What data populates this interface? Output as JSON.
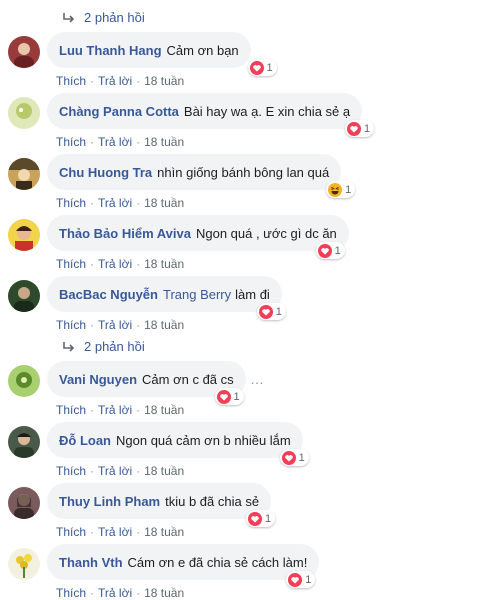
{
  "reply_links": [
    {
      "label": "2 phản hồi"
    },
    {
      "label": "2 phản hồi"
    }
  ],
  "actions": {
    "like": "Thích",
    "reply": "Trả lời",
    "sep": "·"
  },
  "comments": [
    {
      "author": "Luu Thanh Hang",
      "tag": "",
      "text": "Cảm ơn bạn",
      "time": "18 tuần",
      "reaction": "love",
      "count": "1",
      "avatar_color": "#9a3b3b"
    },
    {
      "author": "Chàng Panna Cotta",
      "tag": "",
      "text": "Bài hay wa ạ. E xin chia sẻ ạ",
      "time": "18 tuần",
      "reaction": "love",
      "count": "1",
      "avatar_color": "#b9c86a"
    },
    {
      "author": "Chu Huong Tra",
      "tag": "",
      "text": "nhìn giống bánh bông lan quá",
      "time": "18 tuần",
      "reaction": "haha",
      "count": "1",
      "avatar_color": "#8a6a3a"
    },
    {
      "author": "Thảo Bảo Hiểm Aviva",
      "tag": "",
      "text": "Ngon quá , ước gì dc ăn",
      "time": "18 tuần",
      "reaction": "love",
      "count": "1",
      "avatar_color": "#e0b24a"
    },
    {
      "author": "BacBac Nguyễn",
      "tag": "Trang Berry",
      "text": "làm đi",
      "time": "18 tuần",
      "reaction": "love",
      "count": "1",
      "avatar_color": "#2f4a2a"
    },
    {
      "author": "Vani Nguyen",
      "tag": "",
      "text": "Cảm ơn c đã cs",
      "time": "18 tuần",
      "reaction": "love",
      "count": "1",
      "avatar_color": "#7fae4a"
    },
    {
      "author": "Đỗ Loan",
      "tag": "",
      "text": "Ngon quá cảm ơn b nhiều lắm",
      "time": "18 tuần",
      "reaction": "love",
      "count": "1",
      "avatar_color": "#3a4a3a"
    },
    {
      "author": "Thuy Linh Pham",
      "tag": "",
      "text": "tkiu b đã chia sẻ",
      "time": "18 tuần",
      "reaction": "love",
      "count": "1",
      "avatar_color": "#5a3a3a"
    },
    {
      "author": "Thanh Vth",
      "tag": "",
      "text": "Cám ơn e đã chia sẻ cách làm!",
      "time": "18 tuần",
      "reaction": "love",
      "count": "1",
      "avatar_color": "#d8c24a"
    }
  ],
  "more_icon": "…",
  "colors": {
    "link": "#385898",
    "bubble": "#f2f3f5",
    "meta": "#606770",
    "love": "#f33e58",
    "haha": "#f7b125"
  }
}
